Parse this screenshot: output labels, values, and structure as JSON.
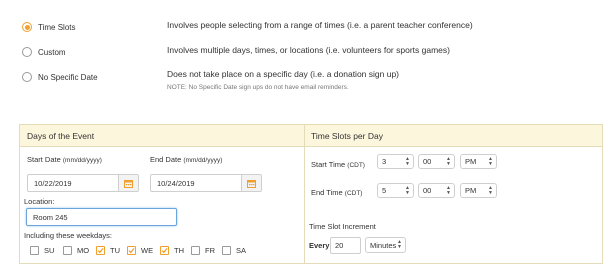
{
  "options": [
    {
      "label": "Time Slots",
      "description": "Involves people selecting from a range of times (i.e. a parent teacher conference)",
      "selected": true
    },
    {
      "label": "Custom",
      "description": "Involves multiple days, times, or locations (i.e. volunteers for sports games)",
      "selected": false
    },
    {
      "label": "No Specific Date",
      "description": "Does not take place on a specific day (i.e. a donation sign up)",
      "selected": false
    }
  ],
  "note": "NOTE: No Specific Date sign ups do not have email reminders.",
  "days": {
    "heading": "Days of the Event",
    "start_label": "Start Date",
    "start_hint": "(mm/dd/yyyy)",
    "start_value": "10/22/2019",
    "end_label": "End Date",
    "end_hint": "(mm/dd/yyyy)",
    "end_value": "10/24/2019",
    "location_label": "Location:",
    "location_value": "Room 245",
    "weekdays_label": "Including these weekdays:",
    "weekdays": [
      {
        "label": "SU",
        "checked": false
      },
      {
        "label": "MO",
        "checked": false
      },
      {
        "label": "TU",
        "checked": true
      },
      {
        "label": "WE",
        "checked": true
      },
      {
        "label": "TH",
        "checked": true
      },
      {
        "label": "FR",
        "checked": false
      },
      {
        "label": "SA",
        "checked": false
      }
    ]
  },
  "slots": {
    "heading": "Time Slots per Day",
    "start_label": "Start Time",
    "start_tz": "(CDT)",
    "start_hour": "3",
    "start_min": "00",
    "start_ampm": "PM",
    "end_label": "End Time",
    "end_tz": "(CDT)",
    "end_hour": "5",
    "end_min": "00",
    "end_ampm": "PM",
    "increment_label": "Time Slot Increment",
    "every_label": "Every",
    "every_value": "20",
    "unit": "Minutes"
  },
  "colors": {
    "accent": "#f0a030",
    "header_bg": "#fcf6dc",
    "focus": "#6aa6dc"
  }
}
